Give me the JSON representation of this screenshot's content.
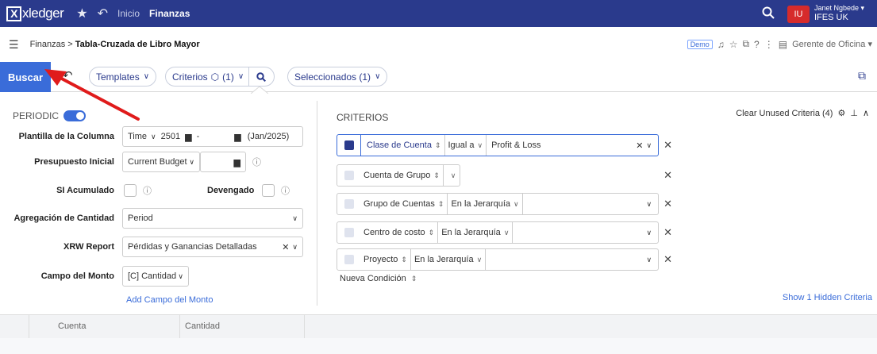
{
  "topbar": {
    "logo_letter": "X",
    "logo_text": "xledger",
    "nav_inicio": "Inicio",
    "nav_finanzas": "Finanzas",
    "avatar_initials": "IU",
    "user_name": "Janet Ngbede ▾",
    "user_org": "IFES UK",
    "bg_color": "#2a3a8c",
    "avatar_color": "#d62b2b"
  },
  "breadcrumb": {
    "parent": "Finanzas >",
    "current": "Tabla-Cruzada de Libro Mayor",
    "demo_badge": "Demo",
    "role": "Gerente de Oficina ▾"
  },
  "toolbar": {
    "buscar_label": "Buscar",
    "templates_label": "Templates",
    "criterios_label": "Criterios",
    "criterios_count": "(1)",
    "seleccionados_label": "Seleccionados (1)",
    "accent_color": "#3a6cd9"
  },
  "left_panel": {
    "periodic_label": "PERIODIC",
    "plantilla": {
      "label": "Plantilla de la Columna",
      "type": "Time",
      "from": "2501",
      "separator": "-",
      "period_label": "(Jan/2025)"
    },
    "presupuesto": {
      "label": "Presupuesto Inicial",
      "value": "Current Budget"
    },
    "si_acumulado_label": "SI Acumulado",
    "devengado_label": "Devengado",
    "agregacion": {
      "label": "Agregación de Cantidad",
      "value": "Period"
    },
    "xrw": {
      "label": "XRW Report",
      "value": "Pérdidas y Ganancias Detalladas"
    },
    "campo": {
      "label": "Campo del Monto",
      "value": "[C] Cantidad"
    },
    "add_campo_link": "Add Campo del Monto"
  },
  "criteria": {
    "title": "CRITERIOS",
    "clear_unused": "Clear Unused Criteria (4)",
    "rows": [
      {
        "field": "Clase de Cuenta",
        "operator": "Igual a",
        "value": "Profit & Loss",
        "active": true
      },
      {
        "field": "Cuenta de Grupo",
        "operator": "",
        "value": "",
        "active": false
      },
      {
        "field": "Grupo de Cuentas",
        "operator": "En la Jerarquía",
        "value": "",
        "active": false
      },
      {
        "field": "Centro de costo",
        "operator": "En la Jerarquía",
        "value": "",
        "active": false
      },
      {
        "field": "Proyecto",
        "operator": "En la Jerarquía",
        "value": "",
        "active": false
      }
    ],
    "nueva_condicion": "Nueva Condición",
    "show_hidden": "Show 1 Hidden Criteria"
  },
  "table": {
    "columns": [
      "Cuenta",
      "Cantidad"
    ]
  },
  "icons": {
    "star": "star-icon",
    "history": "history-icon",
    "search": "search-icon",
    "menu": "hamburger-icon",
    "external": "external-link-icon"
  }
}
